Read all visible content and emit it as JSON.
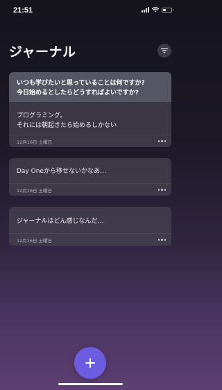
{
  "status_bar": {
    "time": "21:51",
    "battery_level": 0.4
  },
  "header": {
    "title": "ジャーナル",
    "filter_icon": "filter-icon"
  },
  "entries": [
    {
      "prompt_line1": "いつも学びたいと思っていることは何ですか?",
      "prompt_line2": "今日始めるとしたらどうすればよいですか?",
      "body_line1": "プログラミング。",
      "body_line2": "それには朝起きたら始めるしかない",
      "date": "12月16日 土曜日"
    },
    {
      "body_line1": "Day Oneから移せないかなあ…",
      "date": "12月16日 土曜日"
    },
    {
      "body_line1": "ジャーナルはどん感じなんだ…",
      "date": "12月16日 土曜日"
    }
  ],
  "fab": {
    "icon": "plus-icon",
    "color": "#6c5ce0"
  }
}
